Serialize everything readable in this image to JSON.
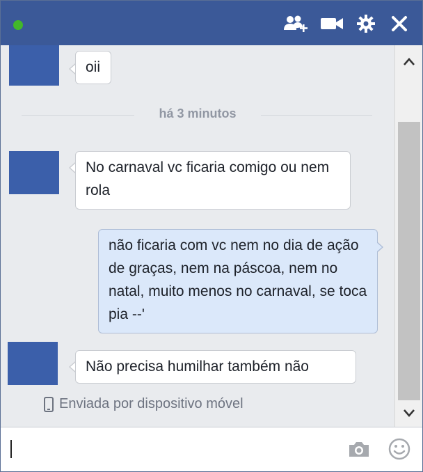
{
  "colors": {
    "titlebar": "#3b5998",
    "online": "#42b72a",
    "my_bubble": "#dbe8fa",
    "their_bubble": "#ffffff"
  },
  "titlebar": {
    "icons": [
      "status-online-dot",
      "add-friend-icon",
      "video-call-icon",
      "gear-icon",
      "close-icon"
    ]
  },
  "conversation": {
    "messages": [
      {
        "from": "them",
        "text": "oii"
      },
      {
        "from": "them",
        "text": "No carnaval vc ficaria comigo ou nem rola"
      },
      {
        "from": "me",
        "text": "não ficaria com vc nem no dia de ação de graças, nem na páscoa, nem no natal, muito menos no carnaval, se toca pia --'"
      },
      {
        "from": "them",
        "text": "Não precisa humilhar também não"
      }
    ],
    "timestamp": "há 3 minutos",
    "sent_via": "Enviada por dispositivo móvel"
  },
  "composer": {
    "value": "",
    "icons": [
      "camera-icon",
      "emoji-icon"
    ]
  }
}
